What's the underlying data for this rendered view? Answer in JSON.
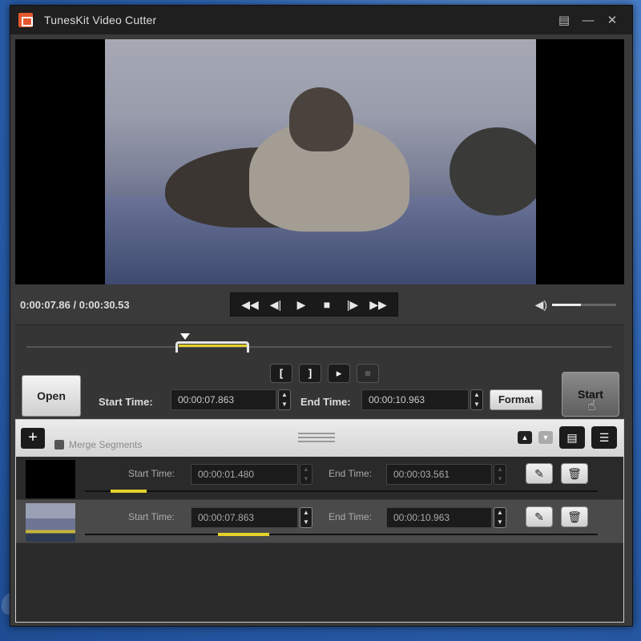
{
  "window": {
    "title": "TunesKit Video Cutter"
  },
  "titlebar_buttons": [
    "restore",
    "minimize",
    "close"
  ],
  "player": {
    "current_time": "0:00:07.86",
    "total_time": "0:00:30.53",
    "time_separator": " / ",
    "transport": [
      "skip-back-icon",
      "step-back-icon",
      "play-icon",
      "stop-icon",
      "step-forward-icon",
      "skip-forward-icon"
    ],
    "volume_level": 0.45
  },
  "editor": {
    "open_label": "Open",
    "start_label": "Start Time:",
    "start_value": "00:00:07.863",
    "end_label": "End Time:",
    "end_value": "00:00:10.963",
    "format_label": "Format",
    "start_button": "Start",
    "marker_buttons": [
      "[",
      "]",
      "▸",
      "■"
    ]
  },
  "segments": {
    "merge_label": "Merge Segments",
    "items": [
      {
        "start_label": "Start Time:",
        "start_value": "00:00:01.480",
        "end_label": "End Time:",
        "end_value": "00:00:03.561",
        "active": false,
        "fill_start": 0.05,
        "fill_width": 0.07
      },
      {
        "start_label": "Start Time:",
        "start_value": "00:00:07.863",
        "end_label": "End Time:",
        "end_value": "00:00:10.963",
        "active": true,
        "fill_start": 0.26,
        "fill_width": 0.1
      }
    ]
  },
  "colors": {
    "accent_yellow": "#e5d22a",
    "panel_dark": "#2b2b2b",
    "title_bg": "#1f1f1f"
  }
}
